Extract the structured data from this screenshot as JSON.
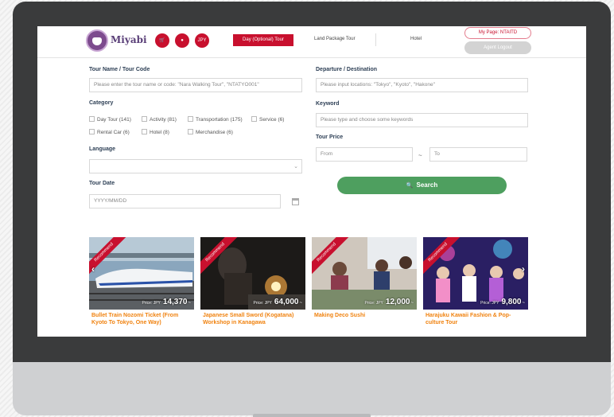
{
  "header": {
    "logo_text": "Miyabi",
    "currency": "JPY",
    "tabs": [
      {
        "label": "Day (Optional) Tour"
      },
      {
        "label": "Land Package Tour"
      },
      {
        "label": "Hotel"
      }
    ],
    "my_page": "My Page: NTAITD",
    "logout": "Agent Logout"
  },
  "form": {
    "tour_name": {
      "label": "Tour Name / Tour Code",
      "placeholder": "Please enter the tour name or code: \"Nara Walking Tour\", \"NTATYO001\""
    },
    "category": {
      "label": "Category",
      "options": [
        "Day Tour (141)",
        "Activity (81)",
        "Transportation (175)",
        "Service (6)",
        "Rental Car (6)",
        "Hotel (8)",
        "Merchandise (6)"
      ]
    },
    "language": {
      "label": "Language",
      "value": ""
    },
    "tour_date": {
      "label": "Tour Date",
      "placeholder": "YYYY/MM/DD"
    },
    "destination": {
      "label": "Departure / Destination",
      "placeholder": "Please input locations: \"Tokyo\", \"Kyoto\", \"Hakone\""
    },
    "keyword": {
      "label": "Keyword",
      "placeholder": "Please type and choose some keywords"
    },
    "price": {
      "label": "Tour Price",
      "from": "From",
      "separator": "~",
      "to": "To"
    },
    "search_button": "Search"
  },
  "cards": [
    {
      "badge": "Recommend",
      "price_label": "Price: JPY",
      "price": "14,370",
      "price_suffix": "~",
      "title": "Bullet Train Nozomi Ticket (From Kyoto To Tokyo, One Way)"
    },
    {
      "badge": "Recommend",
      "price_label": "Price: JPY",
      "price": "64,000",
      "price_suffix": "~",
      "title": "Japanese Small Sword (Kogatana) Workshop in Kanagawa"
    },
    {
      "badge": "Recommend",
      "price_label": "Price: JPY",
      "price": "12,000",
      "price_suffix": "~",
      "title": "Making Deco Sushi"
    },
    {
      "badge": "Recommend",
      "price_label": "Price: JPY",
      "price": "9,800",
      "price_suffix": "~",
      "title": "Harajuku Kawaii Fashion & Pop-culture Tour"
    }
  ],
  "colors": {
    "brand_red": "#c8102e",
    "search_green": "#4e9f5f",
    "card_title_orange": "#f0820f",
    "label_navy": "#2d3f55"
  },
  "icons": {
    "cart": "cart-icon",
    "globe": "globe-icon",
    "calendar": "calendar-icon",
    "search": "search-icon",
    "arrows": [
      "chevron-left-icon",
      "chevron-right-icon"
    ]
  }
}
